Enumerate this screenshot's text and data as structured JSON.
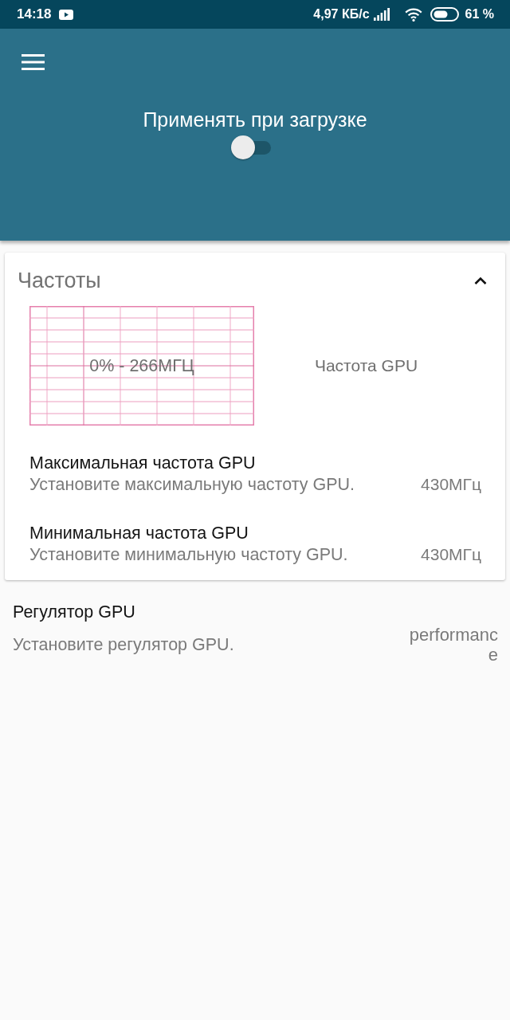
{
  "status_bar": {
    "time": "14:18",
    "network_speed": "4,97 КБ/с",
    "battery": "61 %"
  },
  "header": {
    "apply_on_boot": {
      "label": "Применять при загрузке",
      "on": false
    }
  },
  "frequency_card": {
    "title": "Частоты",
    "expanded": true,
    "graph": {
      "reading": "0% - 266МГЦ",
      "label": "Частота GPU"
    },
    "settings": [
      {
        "title": "Максимальная частота GPU",
        "summary": "Установите максимальную частоту GPU.",
        "value": "430МГц"
      },
      {
        "title": "Минимальная частота GPU",
        "summary": "Установите минимальную частоту GPU.",
        "value": "430МГц"
      }
    ]
  },
  "governor": {
    "title": "Регулятор GPU",
    "summary": "Установите регулятор GPU.",
    "value": "performance"
  }
}
